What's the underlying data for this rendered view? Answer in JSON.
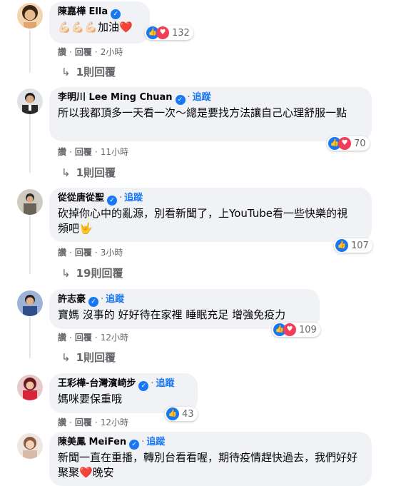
{
  "labels": {
    "like": "讚",
    "reply": "回覆",
    "follow": "追蹤",
    "separator": "·"
  },
  "comments": [
    {
      "name": "陳嘉樺 Ella",
      "text": "💪🏻💪🏻💪🏻加油❤️",
      "reactions": "132",
      "time": "2小時",
      "replies": "1則回覆",
      "avatar_color": "#c98a5a"
    },
    {
      "name": "李明川 Lee Ming Chuan",
      "text": "所以我都頂多一天看一次～總是要找方法讓自己心理舒服一點",
      "reactions": "70",
      "time": "11小時",
      "replies": "1則回覆",
      "avatar_color": "#3b3b3b"
    },
    {
      "name": "從從唐從聖",
      "text": "砍掉你心中的亂源，別看新聞了，上YouTube看一些快樂的視頻吧🤟",
      "reactions": "107",
      "time": "3小時",
      "replies": "19則回覆",
      "avatar_color": "#8a8478"
    },
    {
      "name": "許志豪",
      "text": "寶媽 沒事的 好好待在家裡 睡眠充足 增強免疫力",
      "reactions": "109",
      "time": "12小時",
      "replies": "1則回覆",
      "avatar_color": "#4a6fa5"
    },
    {
      "name": "王彩樺-台灣濱崎步",
      "text": "媽咪要保重哦",
      "reactions": "43",
      "time": "12小時",
      "avatar_color": "#d8364a"
    },
    {
      "name": "陳美鳳 MeiFen",
      "text": "新聞一直在重播，轉別台看看喔，期待疫情趕快過去，我們好好聚聚❤️晚安",
      "avatar_color": "#d9b9a8"
    }
  ]
}
